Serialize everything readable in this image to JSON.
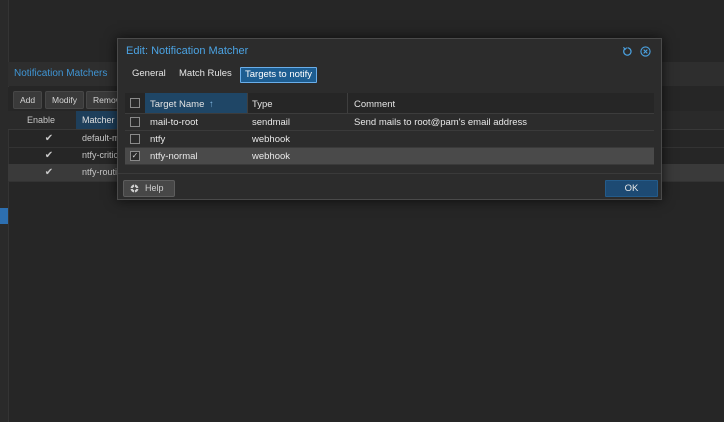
{
  "background": {
    "panel_title": "Notification Matchers",
    "toolbar": {
      "add": "Add",
      "modify": "Modify",
      "remove": "Remov"
    },
    "columns": {
      "enable": "Enable",
      "matcher": "Matcher"
    },
    "rows": [
      {
        "enabled": true,
        "name": "default-m"
      },
      {
        "enabled": true,
        "name": "ntfy-critic"
      },
      {
        "enabled": true,
        "name": "ntfy-routi"
      }
    ]
  },
  "modal": {
    "title": "Edit: Notification Matcher",
    "icons": {
      "reset": "reset-icon",
      "close": "close-icon"
    },
    "tabs": [
      {
        "label": "General",
        "active": false
      },
      {
        "label": "Match Rules",
        "active": false
      },
      {
        "label": "Targets to notify",
        "active": true
      }
    ],
    "grid": {
      "columns": {
        "name": "Target Name",
        "type": "Type",
        "comment": "Comment"
      },
      "sort_indicator": "↑",
      "rows": [
        {
          "checked": false,
          "name": "mail-to-root",
          "type": "sendmail",
          "comment": "Send mails to root@pam's email address"
        },
        {
          "checked": false,
          "name": "ntfy",
          "type": "webhook",
          "comment": ""
        },
        {
          "checked": true,
          "name": "ntfy-normal",
          "type": "webhook",
          "comment": ""
        }
      ]
    },
    "footer": {
      "help": "Help",
      "ok": "OK"
    }
  },
  "colors": {
    "accent": "#4ba3e3",
    "active_tab": "#1d5d91",
    "ok_button": "#1d4a73",
    "background": "#262626"
  }
}
